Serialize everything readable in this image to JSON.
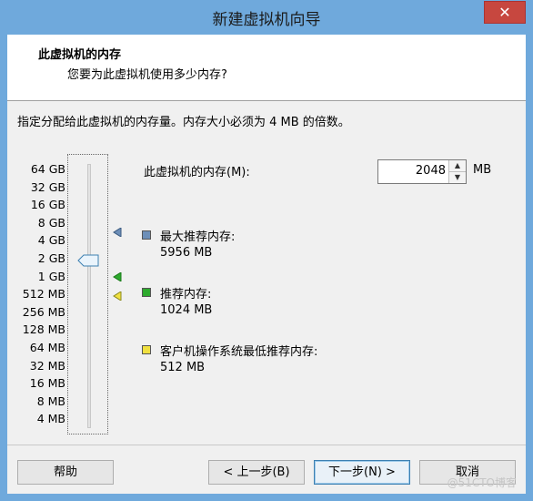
{
  "window": {
    "title": "新建虚拟机向导",
    "close_glyph": "✕"
  },
  "header": {
    "title": "此虚拟机的内存",
    "subtitle": "您要为此虚拟机使用多少内存?"
  },
  "description": "指定分配给此虚拟机的内存量。内存大小必须为 4 MB 的倍数。",
  "slider": {
    "ticks": [
      "64 GB",
      "32 GB",
      "16 GB",
      "8 GB",
      "4 GB",
      "2 GB",
      "1 GB",
      "512 MB",
      "256 MB",
      "128 MB",
      "64 MB",
      "32 MB",
      "16 MB",
      "8 MB",
      "4 MB"
    ],
    "selected_tick": "2 GB"
  },
  "memory": {
    "label": "此虚拟机的内存(M):",
    "value": "2048",
    "unit": "MB"
  },
  "legend": {
    "max": {
      "label": "最大推荐内存:",
      "value": "5956 MB",
      "color": "#6d8fb8"
    },
    "recommended": {
      "label": "推荐内存:",
      "value": "1024 MB",
      "color": "#2eaa2e"
    },
    "guest_min": {
      "label": "客户机操作系统最低推荐内存:",
      "value": "512 MB",
      "color": "#f0e040"
    }
  },
  "buttons": {
    "help": "帮助",
    "back": "< 上一步(B)",
    "next": "下一步(N) >",
    "cancel": "取消"
  },
  "watermark": "@51CTO博客"
}
